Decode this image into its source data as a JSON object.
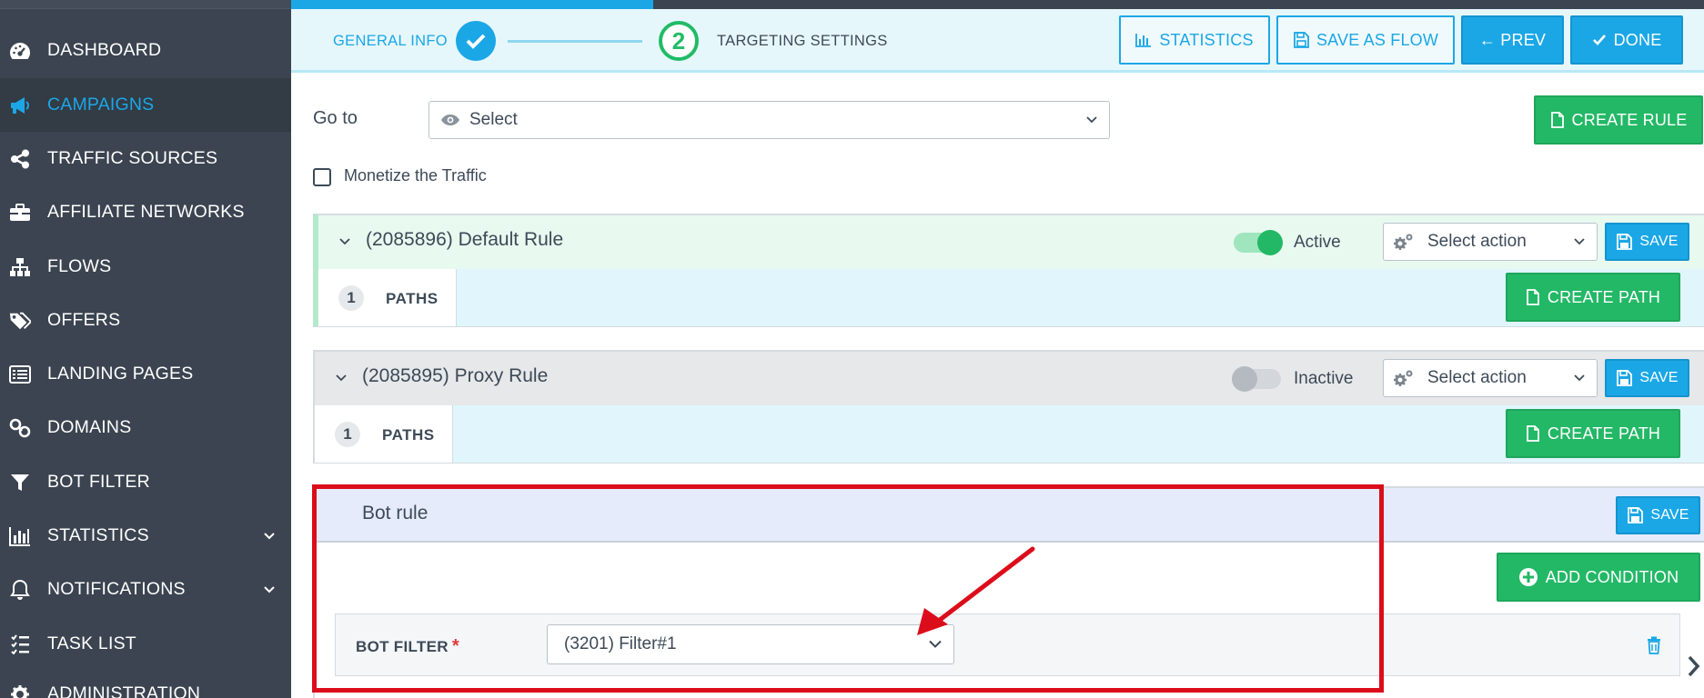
{
  "sidebar": {
    "items": [
      {
        "label": "DASHBOARD",
        "icon": "dashboard-gauge-icon"
      },
      {
        "label": "CAMPAIGNS",
        "icon": "megaphone-icon",
        "active": true
      },
      {
        "label": "TRAFFIC SOURCES",
        "icon": "share-icon"
      },
      {
        "label": "AFFILIATE NETWORKS",
        "icon": "briefcase-icon"
      },
      {
        "label": "FLOWS",
        "icon": "sitemap-icon"
      },
      {
        "label": "OFFERS",
        "icon": "tags-icon"
      },
      {
        "label": "LANDING PAGES",
        "icon": "list-alt-icon"
      },
      {
        "label": "DOMAINS",
        "icon": "link-icon"
      },
      {
        "label": "BOT FILTER",
        "icon": "filter-icon"
      },
      {
        "label": "STATISTICS",
        "icon": "bar-chart-icon",
        "expandable": true
      },
      {
        "label": "NOTIFICATIONS",
        "icon": "bell-icon",
        "expandable": true
      },
      {
        "label": "TASK LIST",
        "icon": "tasks-icon"
      },
      {
        "label": "ADMINISTRATION",
        "icon": "gear-icon"
      }
    ]
  },
  "wizard": {
    "step1": "GENERAL INFO",
    "step2_num": "2",
    "step2": "TARGETING SETTINGS",
    "statistics": "STATISTICS",
    "save_as_flow": "SAVE AS FLOW",
    "prev": "← PREV",
    "done": "DONE"
  },
  "goto": {
    "label": "Go to",
    "value": "Select",
    "create_rule": "CREATE RULE"
  },
  "monetize": {
    "label": "Monetize the Traffic",
    "checked": false
  },
  "rules": [
    {
      "title": "(2085896) Default Rule",
      "status": "Active",
      "action_placeholder": "Select action",
      "save": "SAVE",
      "paths_count": "1",
      "paths_label": "PATHS",
      "create_path": "CREATE PATH"
    },
    {
      "title": "(2085895) Proxy Rule",
      "status": "Inactive",
      "action_placeholder": "Select action",
      "save": "SAVE",
      "paths_count": "1",
      "paths_label": "PATHS",
      "create_path": "CREATE PATH"
    }
  ],
  "bot_rule": {
    "title": "Bot rule",
    "save": "SAVE",
    "add_condition": "ADD CONDITION",
    "field_label": "BOT FILTER",
    "required_mark": "*",
    "value": "(3201) Filter#1"
  },
  "colors": {
    "sidebar_bg": "#3b4450",
    "accent_blue": "#1ba7e6",
    "success_green": "#23b866",
    "highlight_red": "#dc0d1b"
  }
}
